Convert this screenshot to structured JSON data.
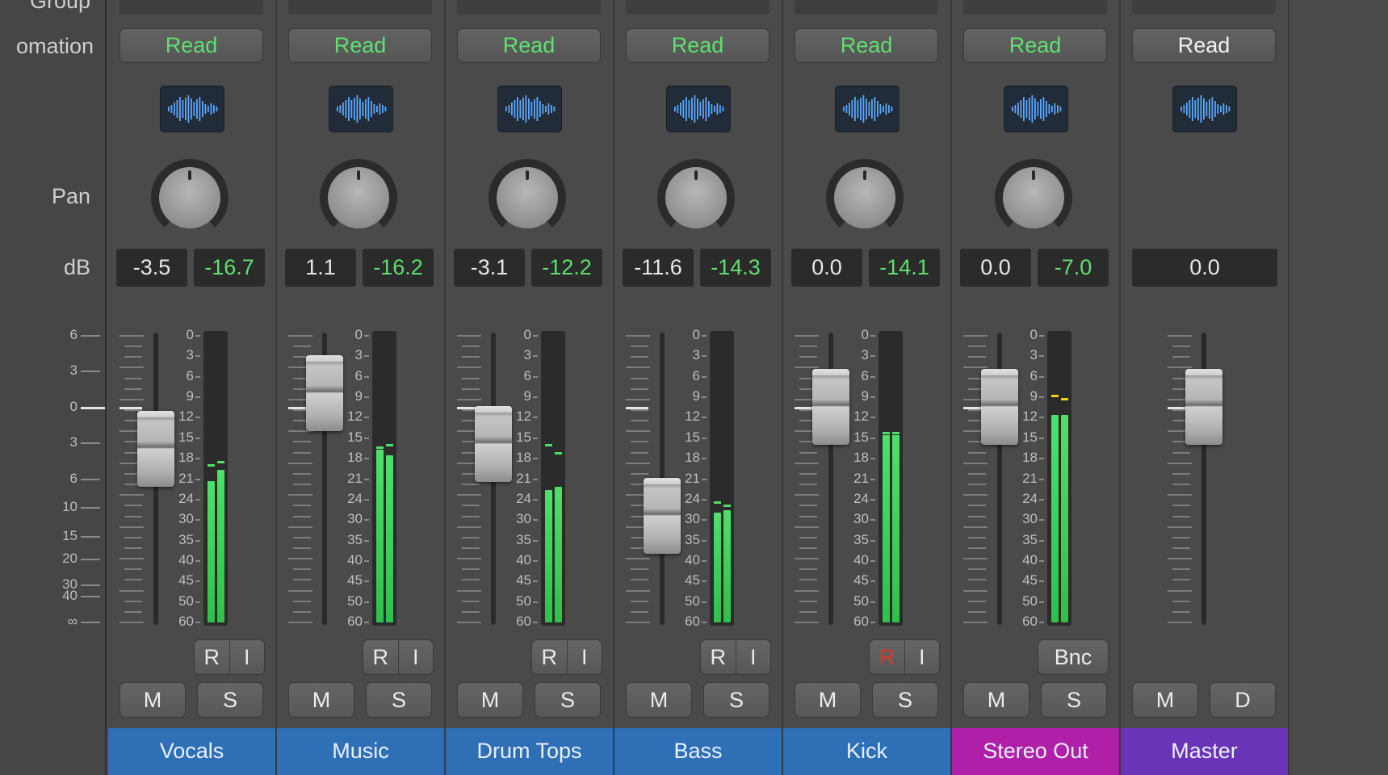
{
  "labels": {
    "group": "Group",
    "automation": "omation",
    "pan": "Pan",
    "db": "dB"
  },
  "master_fader_scale": [
    "6",
    "3",
    "0",
    "3",
    "6",
    "10",
    "15",
    "20",
    "30",
    "40",
    "∞"
  ],
  "meter_scale": [
    "0",
    "3",
    "6",
    "9",
    "12",
    "15",
    "18",
    "21",
    "24",
    "30",
    "35",
    "40",
    "45",
    "50",
    "60"
  ],
  "colors": {
    "read_green": "#5fe070",
    "read_white": "#f0f0f0",
    "peak_green": "#5fe070",
    "rec_red": "#d83a2a",
    "audio_blue": "#2f6fb6",
    "output_magenta": "#b01fa8",
    "master_purple": "#6a34b8",
    "meter_green": "#36cf54"
  },
  "strips": [
    {
      "name": "Vocals",
      "automation": "Read",
      "volume": "-3.5",
      "peak": "-16.7",
      "record": "R",
      "input": "I",
      "mute": "M",
      "solo": "S",
      "type": "audio",
      "fader_db": -3.5,
      "meter_levels": [
        0.49,
        0.53
      ],
      "peak_holds": [
        0.55,
        0.56
      ]
    },
    {
      "name": "Music",
      "automation": "Read",
      "volume": "1.1",
      "peak": "-16.2",
      "record": "R",
      "input": "I",
      "mute": "M",
      "solo": "S",
      "type": "audio",
      "fader_db": 1.1,
      "meter_levels": [
        0.6,
        0.58
      ],
      "peak_holds": [
        0.61,
        0.62
      ]
    },
    {
      "name": "Drum Tops",
      "automation": "Read",
      "volume": "-3.1",
      "peak": "-12.2",
      "record": "R",
      "input": "I",
      "mute": "M",
      "solo": "S",
      "type": "audio",
      "fader_db": -3.1,
      "meter_levels": [
        0.46,
        0.47
      ],
      "peak_holds": [
        0.62,
        0.59
      ]
    },
    {
      "name": "Bass",
      "automation": "Read",
      "volume": "-11.6",
      "peak": "-14.3",
      "record": "R",
      "input": "I",
      "mute": "M",
      "solo": "S",
      "type": "audio",
      "fader_db": -11.6,
      "meter_levels": [
        0.38,
        0.39
      ],
      "peak_holds": [
        0.42,
        0.41
      ]
    },
    {
      "name": "Kick",
      "automation": "Read",
      "volume": "0.0",
      "peak": "-14.1",
      "record": "R",
      "input": "I",
      "mute": "M",
      "solo": "S",
      "type": "audio",
      "record_armed": true,
      "fader_db": 0.0,
      "meter_levels": [
        0.65,
        0.65
      ],
      "peak_holds": [
        0.66,
        0.66
      ]
    },
    {
      "name": "Stereo Out",
      "automation": "Read",
      "volume": "0.0",
      "peak": "-7.0",
      "bounce": "Bnc",
      "mute": "M",
      "solo": "S",
      "type": "output",
      "fader_db": 0.0,
      "meter_levels": [
        0.72,
        0.72
      ],
      "peak_holds": [
        0.79,
        0.78
      ]
    },
    {
      "name": "Master",
      "automation": "Read",
      "volume": "0.0",
      "mute": "M",
      "solo": "D",
      "type": "master",
      "fader_db": 0.0
    }
  ]
}
